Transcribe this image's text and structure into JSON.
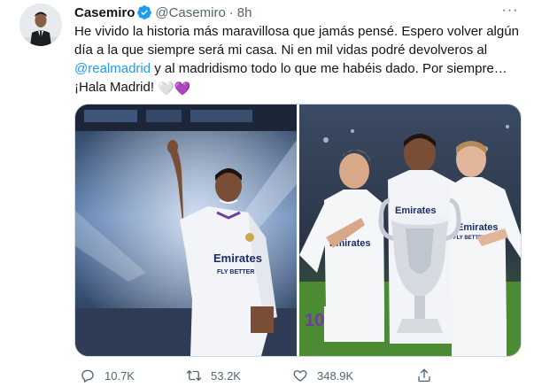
{
  "tweet": {
    "author_name": "Casemiro",
    "handle": "@Casemiro",
    "separator": "·",
    "time": "8h",
    "more_label": "···",
    "text_lines": [
      "He vivido la historia más maravillosa que jamás pensé. Espero volver algún",
      "día a la que siempre será mi casa. Ni en mil vidas podré devolveros al",
      "y al madridismo todo lo que me habéis dado. Por siempre…",
      "¡Hala Madrid!"
    ],
    "mention": "@realmadrid",
    "emoji_white_heart": "🤍",
    "emoji_purple_heart": "💜",
    "media": {
      "left_photo": {
        "shirt_sponsor": "Emirates",
        "shirt_sub": "FLY BETTER"
      },
      "right_photo": {
        "shirt_sponsor": "Emirates",
        "shirt_sub": "FLY BETTER",
        "shirt_number": "10"
      }
    },
    "actions": {
      "reply_count": "10.7K",
      "retweet_count": "53.2K",
      "like_count": "348.9K"
    }
  },
  "colors": {
    "link": "#1d9bf0",
    "verified": "#1d9bf0",
    "secondary_text": "#536471",
    "border": "#cfd9de"
  },
  "icons": [
    "verified-badge-icon",
    "more-icon",
    "reply-icon",
    "retweet-icon",
    "like-icon",
    "share-icon"
  ]
}
